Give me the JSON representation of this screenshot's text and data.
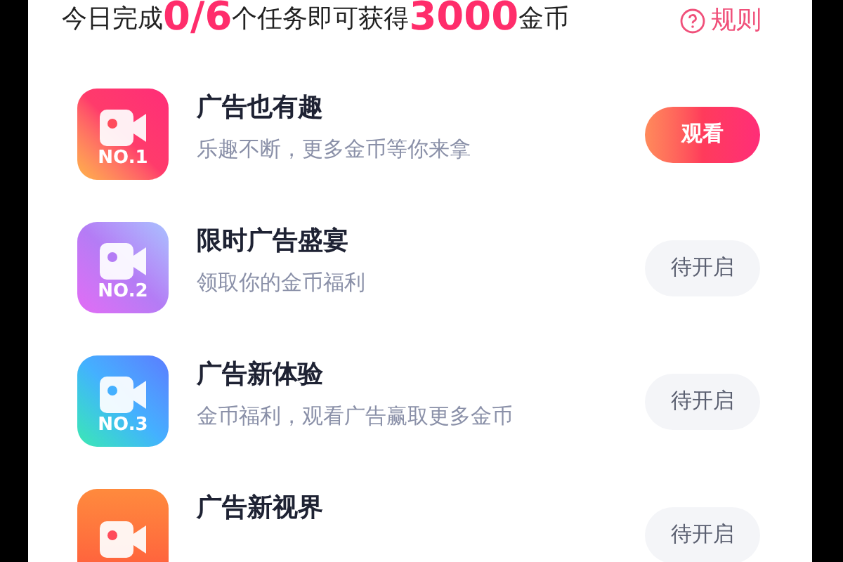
{
  "header": {
    "segments": [
      {
        "text": "今日完成",
        "kind": "plain"
      },
      {
        "text": "0/6",
        "kind": "highlight"
      },
      {
        "text": "个任务即可获得",
        "kind": "plain"
      },
      {
        "text": "3000",
        "kind": "highlight"
      },
      {
        "text": "金币",
        "kind": "plain"
      }
    ],
    "rules_link": "规则"
  },
  "tasks": [
    {
      "badge": "NO.1",
      "kind": "red",
      "title": "广告也有趣",
      "subtitle": "乐趣不断，更多金币等你来拿",
      "action": "观看",
      "enabled": true
    },
    {
      "badge": "NO.2",
      "kind": "purple",
      "title": "限时广告盛宴",
      "subtitle": "领取你的金币福利",
      "action": "待开启",
      "enabled": false
    },
    {
      "badge": "NO.3",
      "kind": "blue",
      "title": "广告新体验",
      "subtitle": "金币福利，观看广告赢取更多金币",
      "action": "待开启",
      "enabled": false
    },
    {
      "kind": "orange",
      "title": "广告新视界",
      "action": "待开启",
      "enabled": false
    }
  ]
}
